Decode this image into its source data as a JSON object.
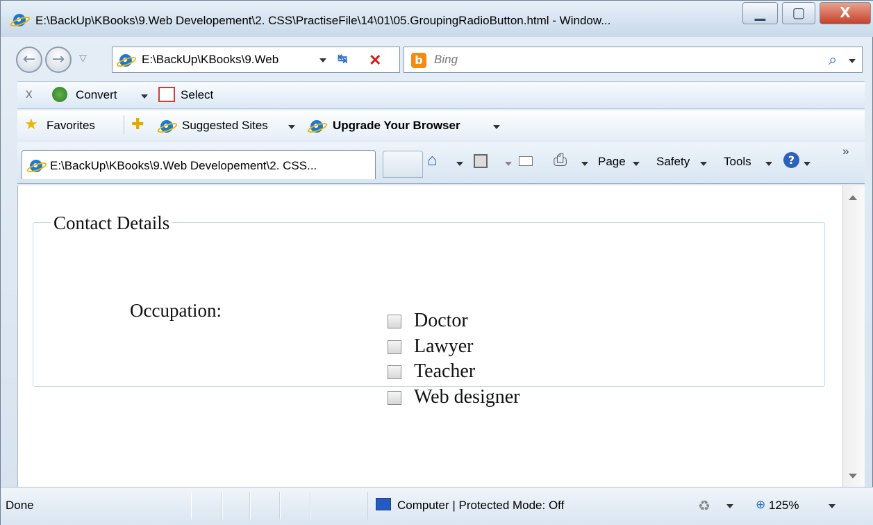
{
  "window": {
    "title": "E:\\BackUp\\KBooks\\9.Web Developement\\2. CSS\\PractiseFile\\14\\01\\05.GroupingRadioButton.html - Window...",
    "buttons": {
      "minimize": "▁",
      "maximize": "▢",
      "close": "X"
    }
  },
  "navigation": {
    "address": "E:\\BackUp\\KBooks\\9.Web",
    "search_placeholder": "Bing"
  },
  "command_bar": {
    "close": "x",
    "convert": "Convert",
    "select": "Select"
  },
  "favorites_bar": {
    "favorites": "Favorites",
    "suggested_sites": "Suggested Sites",
    "upgrade": "Upgrade Your Browser"
  },
  "tabs": [
    {
      "label": "E:\\BackUp\\KBooks\\9.Web Developement\\2. CSS..."
    }
  ],
  "tool_menu": {
    "page": "Page",
    "safety": "Safety",
    "tools": "Tools",
    "overflow": "»"
  },
  "page": {
    "legend": "Contact Details",
    "occupation_label": "Occupation:",
    "options": [
      {
        "label": "Doctor",
        "checked": false
      },
      {
        "label": "Lawyer",
        "checked": false
      },
      {
        "label": "Teacher",
        "checked": false
      },
      {
        "label": "Web designer",
        "checked": false
      }
    ]
  },
  "status_bar": {
    "status": "Done",
    "zone": "Computer | Protected Mode: Off",
    "zoom": "125%"
  },
  "colors": {
    "window_chrome": "#d6e2ee",
    "fieldset_border": "#c5d9e7",
    "close_button": "#c6402a",
    "ie_blue": "#1a78d6"
  },
  "icons": [
    "ie-logo-icon",
    "back-icon",
    "forward-icon",
    "refresh-icon",
    "stop-icon",
    "bing-icon",
    "search-icon",
    "convert-icon",
    "select-icon",
    "favorites-star-icon",
    "add-favorites-icon",
    "home-icon",
    "feeds-icon",
    "mail-icon",
    "print-icon",
    "help-icon",
    "computer-icon",
    "protected-mode-icon",
    "zoom-icon"
  ]
}
